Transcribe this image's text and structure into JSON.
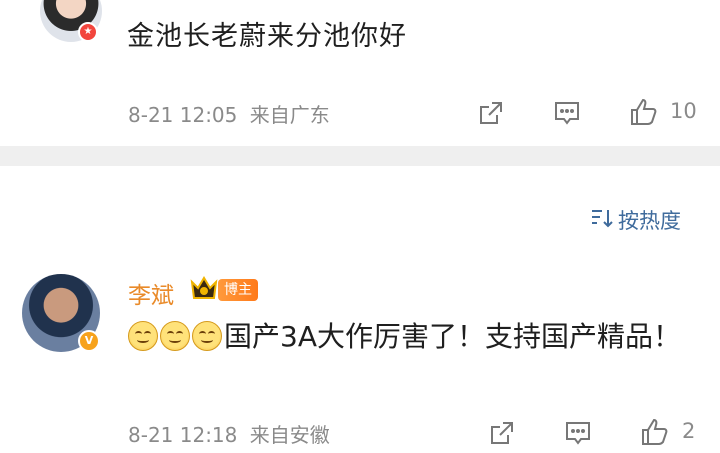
{
  "top_comment": {
    "text": "金池长老蔚来分池你好",
    "timestamp": "8-21 12:05",
    "location": "来自广东",
    "like_count": "10"
  },
  "sort": {
    "label": "按热度",
    "icon": "sort-icon"
  },
  "blogger_comment": {
    "username": "李斌",
    "tag": "博主",
    "emoji_count": 3,
    "text": "国产3A大作厉害了！支持国产精品！",
    "timestamp": "8-21 12:18",
    "location": "来自安徽",
    "like_count": "2"
  },
  "colors": {
    "username": "#e98a29",
    "sort_link": "#3f6b9c",
    "meta": "#8a8a8a",
    "divider": "#efefef"
  }
}
